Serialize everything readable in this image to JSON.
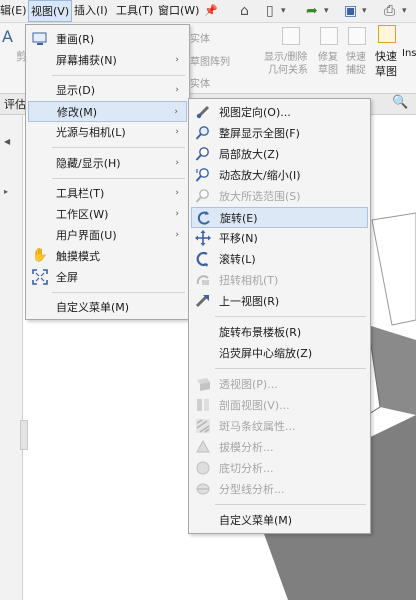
{
  "menubar": {
    "items": [
      "辑(E)",
      "视图(V)",
      "插入(I)",
      "工具(T)",
      "窗口(W)"
    ],
    "pin_icon": "pin-icon"
  },
  "ribbon": {
    "labels": [
      "实体",
      "草图阵列",
      "实体",
      "显示/删除",
      "几何关系",
      "修复",
      "草图",
      "快速",
      "捕捉",
      "快速",
      "草图",
      "Ins"
    ],
    "left_letters": [
      "A",
      "剪"
    ],
    "tab_label": "评估"
  },
  "view_menu": {
    "items": [
      {
        "label": "重画(R)",
        "icon": "redraw-icon",
        "arrow": false
      },
      {
        "label": "屏幕捕获(N)",
        "icon": "",
        "arrow": true
      },
      {
        "label": "显示(D)",
        "icon": "",
        "arrow": true
      },
      {
        "label": "修改(M)",
        "icon": "",
        "arrow": true
      },
      {
        "label": "光源与相机(L)",
        "icon": "",
        "arrow": true
      },
      {
        "label": "隐藏/显示(H)",
        "icon": "",
        "arrow": true
      },
      {
        "label": "工具栏(T)",
        "icon": "",
        "arrow": true
      },
      {
        "label": "工作区(W)",
        "icon": "",
        "arrow": true
      },
      {
        "label": "用户界面(U)",
        "icon": "",
        "arrow": true
      },
      {
        "label": "触摸模式",
        "icon": "hand-icon",
        "arrow": false
      },
      {
        "label": "全屏",
        "icon": "fullscreen-icon",
        "arrow": false
      },
      {
        "label": "自定义菜单(M)",
        "icon": "",
        "arrow": false
      }
    ]
  },
  "modify_menu": {
    "items": [
      {
        "label": "视图定向(O)...",
        "icon": "view-orientation-icon",
        "enabled": true
      },
      {
        "label": "整屏显示全图(F)",
        "icon": "zoom-to-fit-icon",
        "enabled": true
      },
      {
        "label": "局部放大(Z)",
        "icon": "zoom-area-icon",
        "enabled": true
      },
      {
        "label": "动态放大/缩小(I)",
        "icon": "zoom-in-out-icon",
        "enabled": true
      },
      {
        "label": "放大所选范围(S)",
        "icon": "zoom-selection-icon",
        "enabled": false
      },
      {
        "label": "旋转(E)",
        "icon": "rotate-icon",
        "enabled": true
      },
      {
        "label": "平移(N)",
        "icon": "pan-icon",
        "enabled": true
      },
      {
        "label": "滚转(L)",
        "icon": "roll-icon",
        "enabled": true
      },
      {
        "label": "扭转相机(T)",
        "icon": "turn-camera-icon",
        "enabled": false
      },
      {
        "label": "上一视图(R)",
        "icon": "previous-view-icon",
        "enabled": true
      },
      {
        "label": "旋转布景楼板(R)",
        "icon": "",
        "enabled": true
      },
      {
        "label": "沿荧屏中心缩放(Z)",
        "icon": "",
        "enabled": true
      },
      {
        "label": "透视图(P)...",
        "icon": "perspective-icon",
        "enabled": false
      },
      {
        "label": "剖面视图(V)...",
        "icon": "section-view-icon",
        "enabled": false
      },
      {
        "label": "斑马条纹属性...",
        "icon": "zebra-stripes-icon",
        "enabled": false
      },
      {
        "label": "拔模分析...",
        "icon": "draft-analysis-icon",
        "enabled": false
      },
      {
        "label": "底切分析...",
        "icon": "undercut-analysis-icon",
        "enabled": false
      },
      {
        "label": "分型线分析...",
        "icon": "parting-line-icon",
        "enabled": false
      },
      {
        "label": "自定义菜单(M)",
        "icon": "",
        "enabled": true
      }
    ]
  },
  "colors": {
    "highlight": "#dce8f6",
    "highlight_border": "#a9c3e4",
    "disabled_text": "#a6a6a6",
    "menu_bg": "#f4f4f4",
    "drawing_gray": "#7f7f7f"
  }
}
